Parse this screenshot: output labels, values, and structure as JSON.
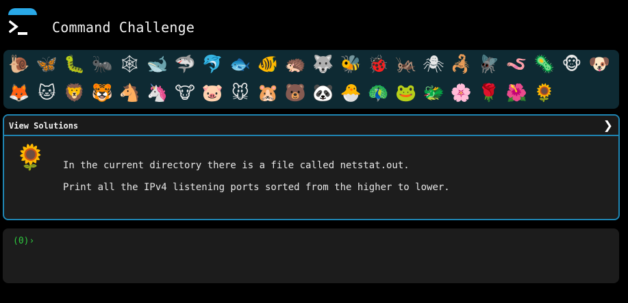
{
  "header": {
    "title": "Command Challenge",
    "logo_icon": "terminal-prompt-icon",
    "accent_color": "#29a9e8"
  },
  "challenges": {
    "row1": [
      {
        "icon": "snail-icon",
        "glyph": "🐌"
      },
      {
        "icon": "butterfly-icon",
        "glyph": "🦋"
      },
      {
        "icon": "caterpillar-icon",
        "glyph": "🐛"
      },
      {
        "icon": "ant-icon",
        "glyph": "🐜"
      },
      {
        "icon": "spider-web-icon",
        "glyph": "🕸"
      },
      {
        "icon": "whale-icon",
        "glyph": "🐋"
      },
      {
        "icon": "shark-icon",
        "glyph": "🦈"
      },
      {
        "icon": "dolphin-icon",
        "glyph": "🐬"
      },
      {
        "icon": "fish-icon",
        "glyph": "🐟"
      },
      {
        "icon": "tropical-fish-icon",
        "glyph": "🐠"
      },
      {
        "icon": "hedgehog-icon",
        "glyph": "🦔"
      },
      {
        "icon": "wolf-icon",
        "glyph": "🐺"
      },
      {
        "icon": "bee-icon",
        "glyph": "🐝"
      },
      {
        "icon": "ladybug-icon",
        "glyph": "🐞"
      },
      {
        "icon": "cricket-icon",
        "glyph": "🦗"
      },
      {
        "icon": "spider-icon",
        "glyph": "🕷"
      },
      {
        "icon": "scorpion-icon",
        "glyph": "🦂"
      },
      {
        "icon": "fly-icon",
        "glyph": "🪰"
      },
      {
        "icon": "worm-icon",
        "glyph": "🪱"
      },
      {
        "icon": "microbe-icon",
        "glyph": "🦠"
      },
      {
        "icon": "monkey-icon",
        "glyph": "🐵"
      },
      {
        "icon": "dog-icon",
        "glyph": "🐶"
      }
    ],
    "row2": [
      {
        "icon": "fox-icon",
        "glyph": "🦊"
      },
      {
        "icon": "cat-icon",
        "glyph": "🐱"
      },
      {
        "icon": "lion-icon",
        "glyph": "🦁"
      },
      {
        "icon": "tiger-icon",
        "glyph": "🐯"
      },
      {
        "icon": "horse-icon",
        "glyph": "🐴"
      },
      {
        "icon": "unicorn-icon",
        "glyph": "🦄"
      },
      {
        "icon": "cow-icon",
        "glyph": "🐮"
      },
      {
        "icon": "pig-icon",
        "glyph": "🐷"
      },
      {
        "icon": "mouse-icon",
        "glyph": "🐭"
      },
      {
        "icon": "hamster-icon",
        "glyph": "🐹"
      },
      {
        "icon": "bear-icon",
        "glyph": "🐻"
      },
      {
        "icon": "panda-icon",
        "glyph": "🐼"
      },
      {
        "icon": "hatching-chick-icon",
        "glyph": "🐣"
      },
      {
        "icon": "peacock-icon",
        "glyph": "🦚"
      },
      {
        "icon": "frog-icon",
        "glyph": "🐸"
      },
      {
        "icon": "dragon-icon",
        "glyph": "🐲"
      },
      {
        "icon": "cherry-blossom-icon",
        "glyph": "🌸"
      },
      {
        "icon": "rose-icon",
        "glyph": "🌹"
      },
      {
        "icon": "hibiscus-icon",
        "glyph": "🌺"
      },
      {
        "icon": "sunflower-icon",
        "glyph": "🌻"
      }
    ]
  },
  "solutions": {
    "label": "View Solutions",
    "chevron_icon": "chevron-right-icon",
    "chevron_glyph": "❯",
    "border_color": "#1f86b4"
  },
  "challenge": {
    "icon": "sunflower-icon",
    "glyph": "🌻",
    "line1": "In the current directory there is a file called netstat.out.",
    "line2": "Print all the IPv4 listening ports sorted from the higher to lower."
  },
  "terminal": {
    "prompt": "(0)›",
    "input_value": "",
    "prompt_color": "#2ecc40"
  }
}
